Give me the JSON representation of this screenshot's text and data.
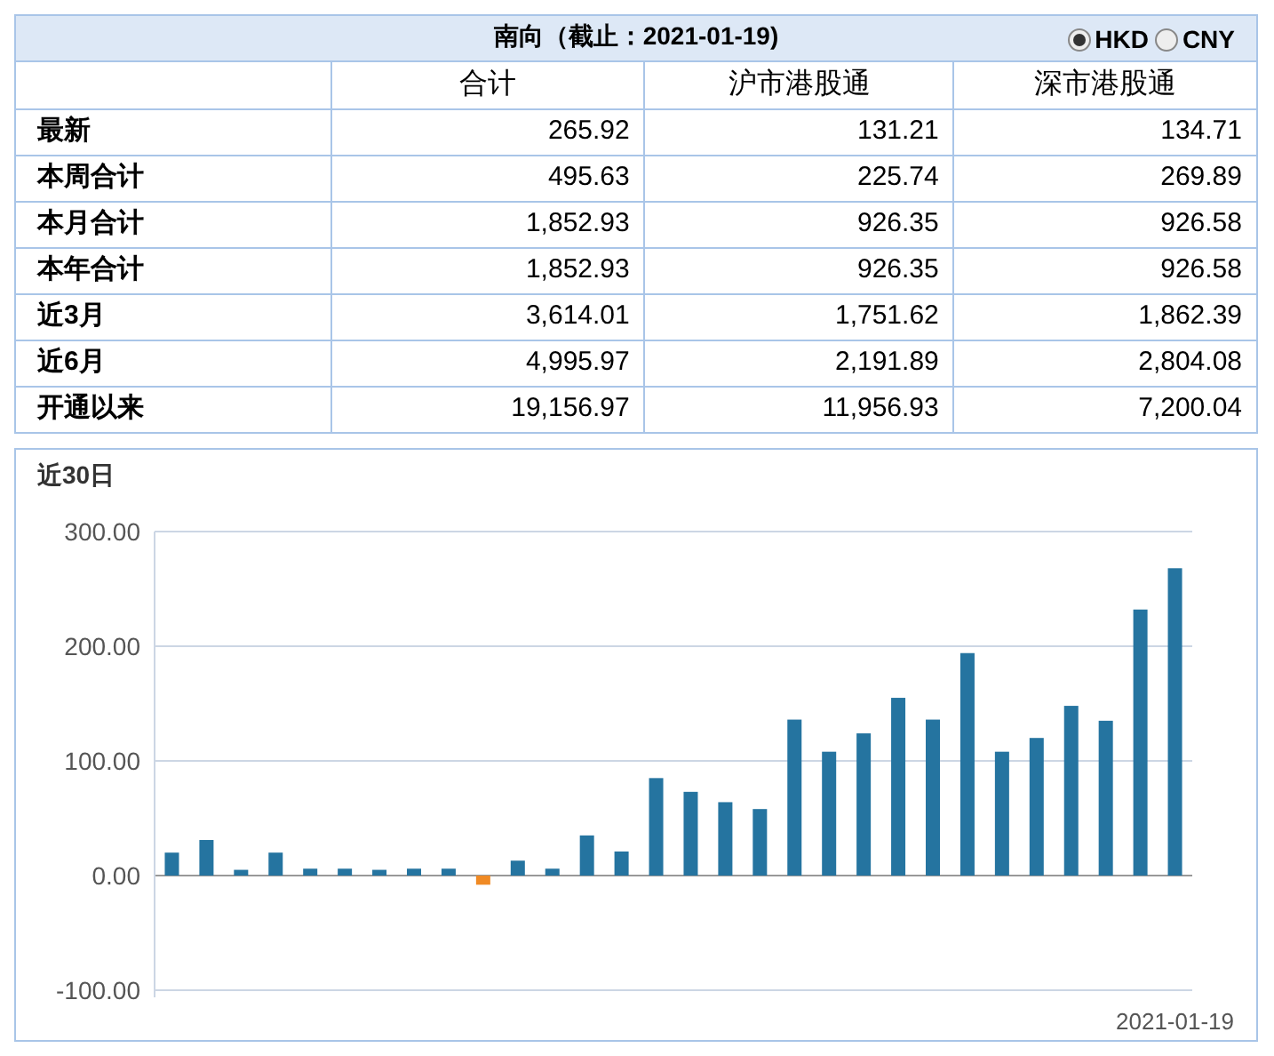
{
  "table": {
    "title": "南向（截止：2021-01-19)",
    "currency_options": [
      {
        "label": "HKD",
        "selected": true
      },
      {
        "label": "CNY",
        "selected": false
      }
    ],
    "columns": [
      "合计",
      "沪市港股通",
      "深市港股通"
    ],
    "rows": [
      {
        "label": "最新",
        "values": [
          "265.92",
          "131.21",
          "134.71"
        ]
      },
      {
        "label": "本周合计",
        "values": [
          "495.63",
          "225.74",
          "269.89"
        ]
      },
      {
        "label": "本月合计",
        "values": [
          "1,852.93",
          "926.35",
          "926.58"
        ]
      },
      {
        "label": "本年合计",
        "values": [
          "1,852.93",
          "926.35",
          "926.58"
        ]
      },
      {
        "label": "近3月",
        "values": [
          "3,614.01",
          "1,751.62",
          "1,862.39"
        ]
      },
      {
        "label": "近6月",
        "values": [
          "4,995.97",
          "2,191.89",
          "2,804.08"
        ]
      },
      {
        "label": "开通以来",
        "values": [
          "19,156.97",
          "11,956.93",
          "7,200.04"
        ]
      }
    ]
  },
  "chart": {
    "title": "近30日",
    "chart_data": {
      "type": "bar",
      "ylim": [
        -100,
        300
      ],
      "yticks": [
        {
          "value": -100,
          "label": "-100.00"
        },
        {
          "value": 0,
          "label": "0.00"
        },
        {
          "value": 100,
          "label": "100.00"
        },
        {
          "value": 200,
          "label": "200.00"
        },
        {
          "value": 300,
          "label": "300.00"
        }
      ],
      "categories": [
        null,
        null,
        null,
        null,
        null,
        null,
        null,
        null,
        null,
        null,
        null,
        null,
        null,
        null,
        null,
        null,
        null,
        null,
        null,
        null,
        null,
        null,
        null,
        null,
        null,
        null,
        null,
        null,
        null,
        "2021-01-19"
      ],
      "series": [
        {
          "color": "#2574a0",
          "values": [
            20,
            31,
            5,
            20,
            6,
            6,
            5,
            6,
            6,
            null,
            13,
            6,
            35,
            21,
            85,
            73,
            64,
            58,
            136,
            108,
            124,
            155,
            136,
            194,
            108,
            120,
            148,
            135,
            232,
            268
          ]
        },
        {
          "color": "#f08a24",
          "values": [
            null,
            null,
            null,
            null,
            null,
            null,
            null,
            null,
            null,
            -8,
            null,
            null,
            null,
            null,
            null,
            null,
            null,
            null,
            null,
            null,
            null,
            null,
            null,
            null,
            null,
            null,
            null,
            null,
            null,
            null
          ]
        }
      ]
    }
  }
}
